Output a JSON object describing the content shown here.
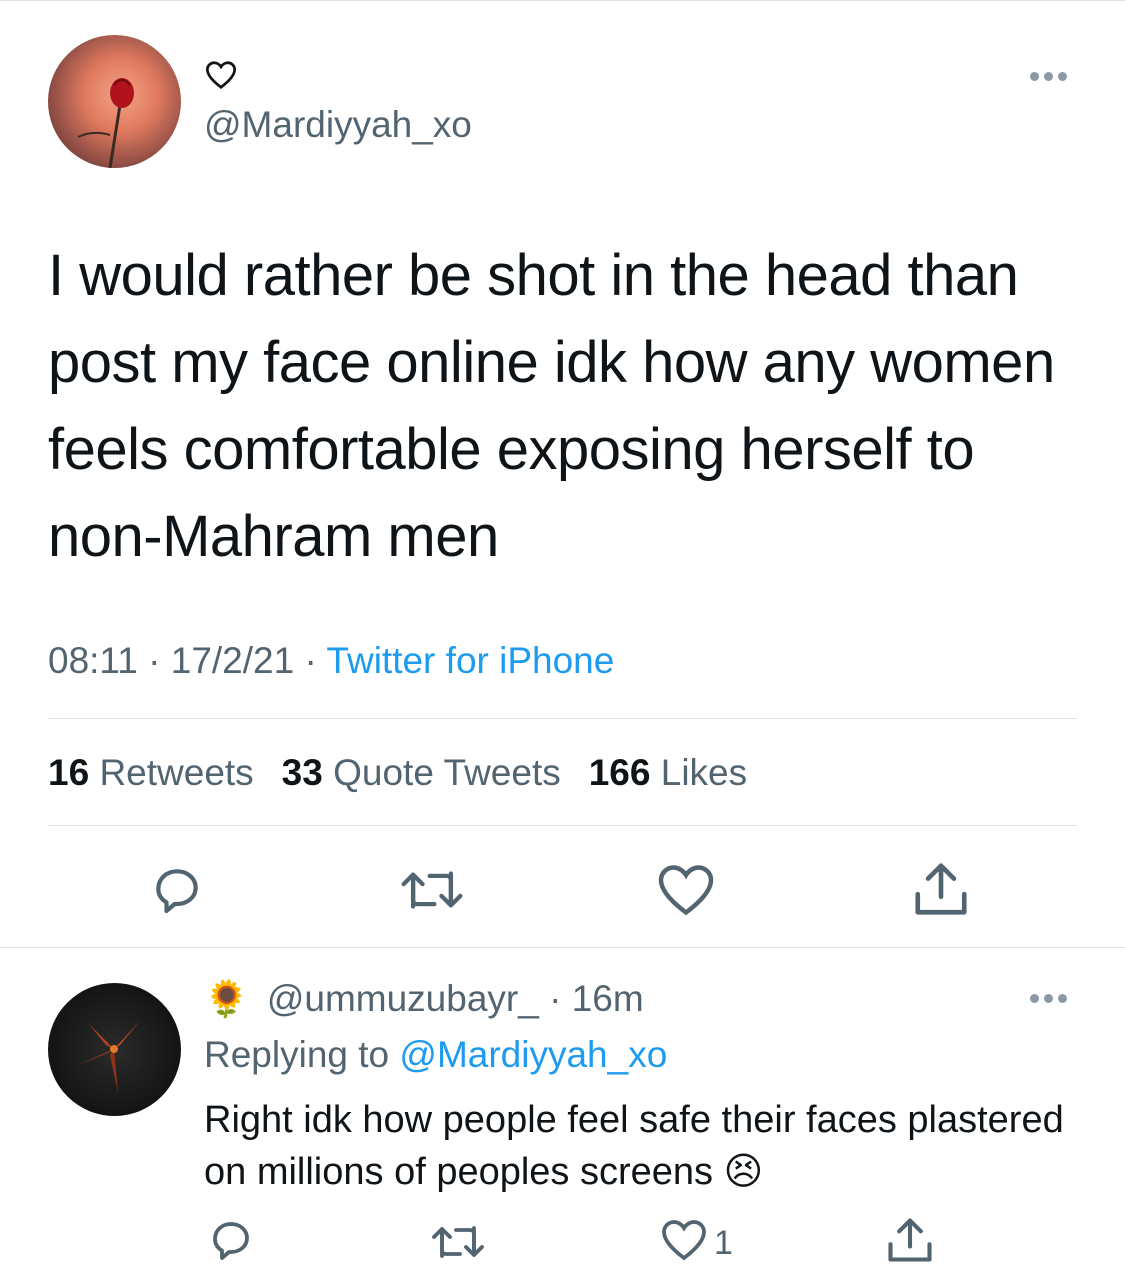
{
  "main_tweet": {
    "handle": "@Mardiyyah_xo",
    "text": "I would rather be shot in the head than\npost my face online idk how any women\nfeels comfortable exposing herself to\nnon-Mahram men",
    "time": "08:11",
    "separator": " · ",
    "date": "17/2/21",
    "source": "Twitter for iPhone",
    "stats": {
      "retweets_count": "16",
      "retweets_label": "Retweets",
      "quotes_count": "33",
      "quotes_label": "Quote Tweets",
      "likes_count": "166",
      "likes_label": "Likes"
    }
  },
  "reply": {
    "name_emoji": "🌻",
    "handle": "@ummuzubayr_",
    "separator": " · ",
    "age": "16m",
    "replying_label": "Replying to",
    "replying_to": "@Mardiyyah_xo",
    "text": "Right idk how people feel safe their faces plastered on millions of peoples screens",
    "emoji": "😣",
    "like_count": "1"
  },
  "colors": {
    "text": "#0f1419",
    "secondary": "#536471",
    "link": "#1d9bf0",
    "divider": "#dfe3e6"
  },
  "icons": [
    "heart-icon",
    "more-icon",
    "reply-icon",
    "retweet-icon",
    "like-icon",
    "share-icon"
  ]
}
